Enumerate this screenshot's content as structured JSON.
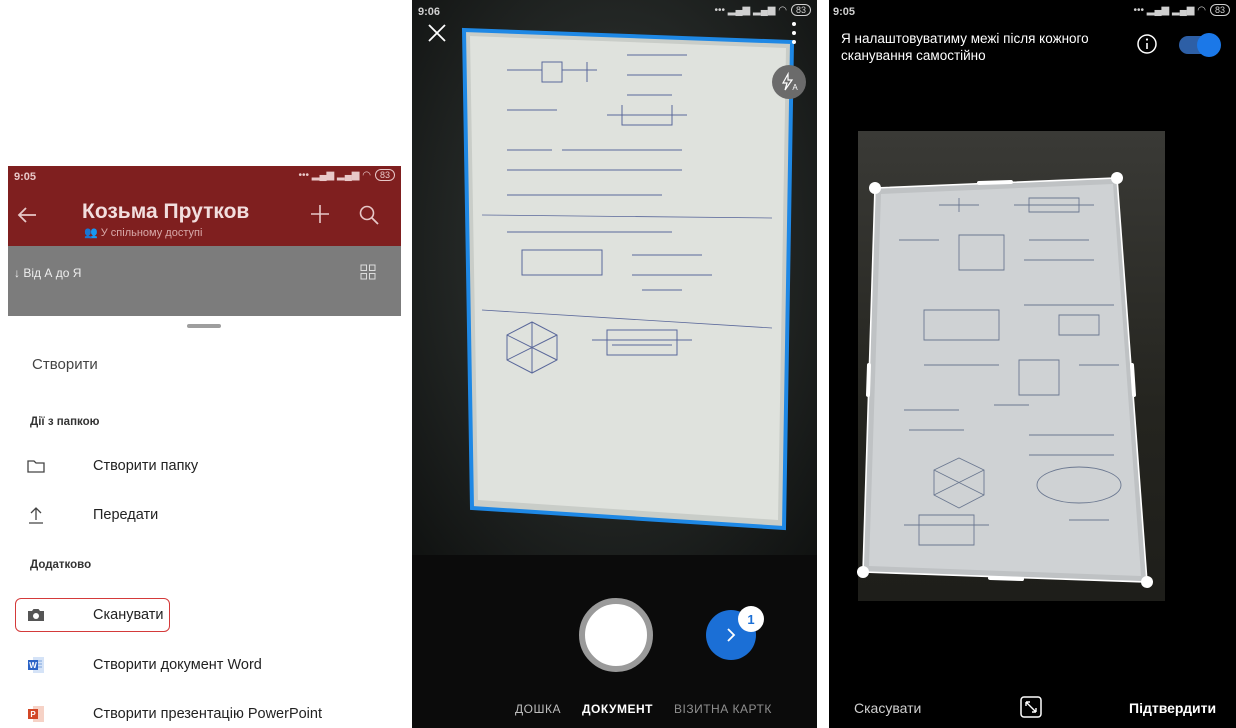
{
  "screen1": {
    "status_time": "9:05",
    "battery": "83",
    "folder_title": "Козьма Прутков",
    "shared_label": "У спільному доступі",
    "sort_label": "Від А до Я",
    "sheet": {
      "title": "Створити",
      "section_folder": "Дії з папкою",
      "create_folder": "Створити папку",
      "upload": "Передати",
      "section_more": "Додатково",
      "scan": "Сканувати",
      "create_word": "Створити документ Word",
      "create_ppt": "Створити презентацію PowerPoint"
    },
    "colors": {
      "header": "#7f1f1f",
      "highlight": "#d43a3a"
    }
  },
  "screen2": {
    "status_time": "9:06",
    "battery": "83",
    "capture_count": "1",
    "modes": [
      "ДОШКА",
      "ДОКУМЕНТ",
      "ВІЗИТНА КАРТК"
    ],
    "selected_mode": "ДОКУМЕНТ",
    "colors": {
      "frame": "#1e88e5",
      "next_button": "#1b6fd6"
    }
  },
  "screen3": {
    "status_time": "9:05",
    "battery": "83",
    "hint": "Я налаштовуватиму межі після кожного сканування самостійно",
    "toggle_on": true,
    "cancel": "Скасувати",
    "confirm": "Підтвердити"
  }
}
